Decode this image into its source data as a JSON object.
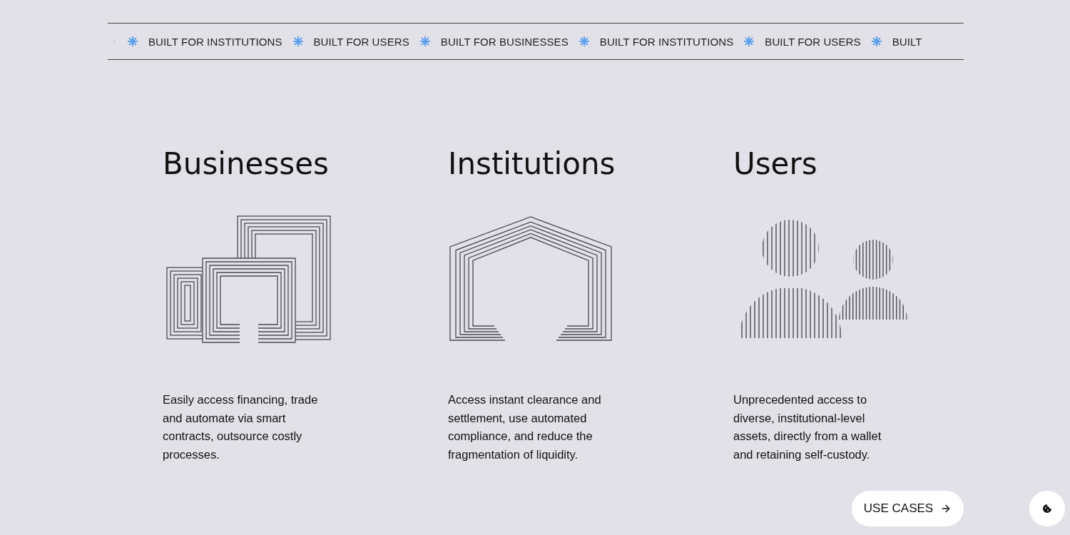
{
  "ticker": [
    {
      "text": "BUILT FOR INSTITUTIONS"
    },
    {
      "text": "BUILT FOR USERS"
    },
    {
      "text": "BUILT FOR BUSINESSES"
    },
    {
      "text": "BUILT FOR INSTITUTIONS"
    },
    {
      "text": "BUILT FOR USERS"
    },
    {
      "text": "BUILT"
    }
  ],
  "columns": [
    {
      "title": "Businesses",
      "kind": "buildings",
      "description": "Easily access financing, trade and automate via smart contracts, outsource costly processes."
    },
    {
      "title": "Institutions",
      "kind": "house",
      "description": "Access instant clearance and settlement, use automated compliance, and reduce the fragmentation of liquidity."
    },
    {
      "title": "Users",
      "kind": "people",
      "description": "Unprecedented access to diverse, institutional-level assets, directly from a wallet and retaining self-custody."
    }
  ],
  "cta": {
    "label": "USE CASES"
  }
}
